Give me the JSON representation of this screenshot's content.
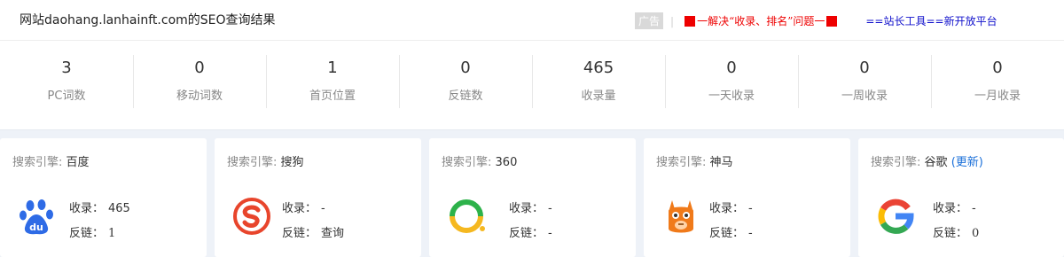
{
  "header": {
    "title": "网站daohang.lanhainft.com的SEO查询结果",
    "ad_badge": "广告",
    "ad_red_text": "一解决“收录、排名”问题一",
    "ad_blue_text": "==站长工具==新开放平台"
  },
  "stats": [
    {
      "value": "3",
      "label": "PC词数"
    },
    {
      "value": "0",
      "label": "移动词数"
    },
    {
      "value": "1",
      "label": "首页位置"
    },
    {
      "value": "0",
      "label": "反链数"
    },
    {
      "value": "465",
      "label": "收录量"
    },
    {
      "value": "0",
      "label": "一天收录"
    },
    {
      "value": "0",
      "label": "一周收录"
    },
    {
      "value": "0",
      "label": "一月收录"
    }
  ],
  "engine_prefix": "搜索引擎:",
  "index_key": "收录：",
  "backlink_key": "反链：",
  "engines": [
    {
      "name": "百度",
      "index": "465",
      "backlink": "1",
      "logo": "baidu-paw-icon"
    },
    {
      "name": "搜狗",
      "index": "-",
      "backlink": "查询",
      "logo": "sogou-s-icon"
    },
    {
      "name": "360",
      "index": "-",
      "backlink": "-",
      "logo": "360-ring-icon"
    },
    {
      "name": "神马",
      "index": "-",
      "backlink": "-",
      "logo": "shenma-alpaca-icon"
    },
    {
      "name": "谷歌",
      "update_link": "(更新)",
      "index": "-",
      "backlink": "0",
      "logo": "google-g-icon"
    }
  ],
  "colors": {
    "ad_red": "#ee0000",
    "ad_blue": "#1111cc",
    "link_blue": "#1a6fd9",
    "page_bg": "#eef2f8"
  }
}
